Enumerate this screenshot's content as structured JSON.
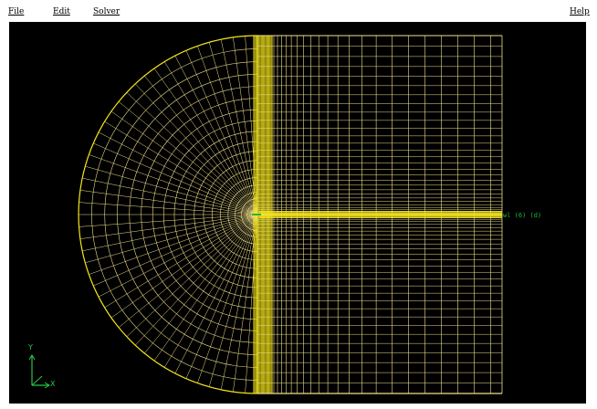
{
  "menubar": {
    "file_label": "File",
    "edit_label": "Edit",
    "solver_label": "Solver",
    "help_label": "Help"
  },
  "viewport": {
    "zone_label": "wl (6) (d)",
    "axis_x_label": "X",
    "axis_y_label": "Y"
  },
  "colors": {
    "mesh_line": "#efdf8a",
    "mesh_dense": "#f4e51a",
    "background": "#000000",
    "label": "#26b53a",
    "axis_triad": "#27c94a"
  }
}
